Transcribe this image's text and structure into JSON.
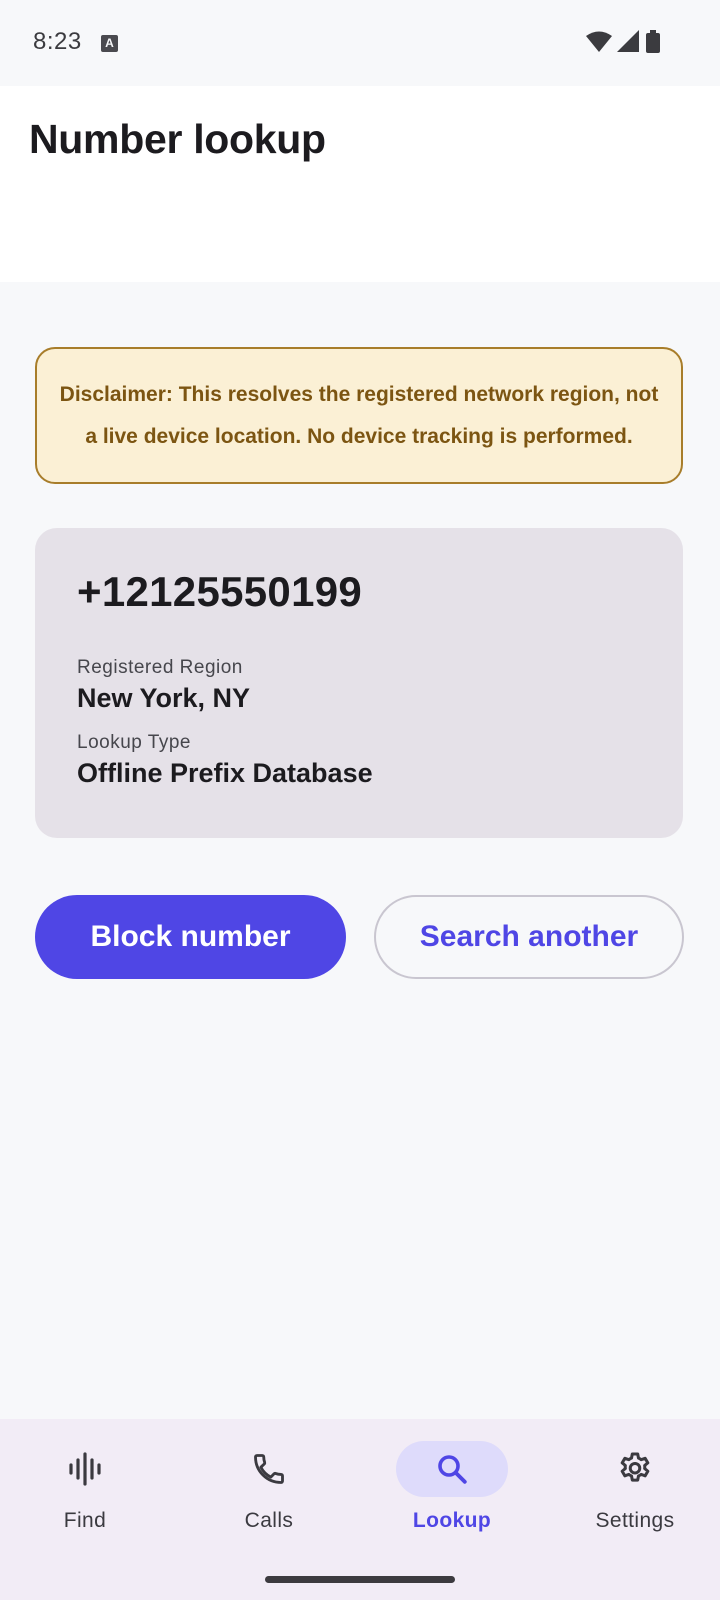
{
  "status_bar": {
    "time": "8:23",
    "notification_icon": "a-letter-icon",
    "icons": [
      "wifi-icon",
      "signal-icon",
      "battery-icon"
    ]
  },
  "header": {
    "title": "Number lookup"
  },
  "disclaimer": {
    "text": "Disclaimer: This resolves the registered network region, not a live device location. No device tracking is performed."
  },
  "result": {
    "phone_number": "+12125550199",
    "region_label": "Registered Region",
    "region_value": "New York, NY",
    "type_label": "Lookup Type",
    "type_value": "Offline Prefix Database"
  },
  "actions": {
    "block_label": "Block number",
    "search_label": "Search another"
  },
  "bottom_nav": {
    "items": [
      {
        "label": "Find",
        "icon": "waveform-icon",
        "active": false
      },
      {
        "label": "Calls",
        "icon": "phone-icon",
        "active": false
      },
      {
        "label": "Lookup",
        "icon": "search-icon",
        "active": true
      },
      {
        "label": "Settings",
        "icon": "gear-icon",
        "active": false
      }
    ]
  },
  "colors": {
    "accent": "#4f46e5",
    "disclaimer_bg": "#fbf0d5",
    "disclaimer_border": "#a87d2a",
    "disclaimer_text": "#7c5512",
    "card_bg": "#e5e1e8",
    "nav_bg": "#f2ecf6",
    "nav_active_pill": "#dedbfb"
  }
}
